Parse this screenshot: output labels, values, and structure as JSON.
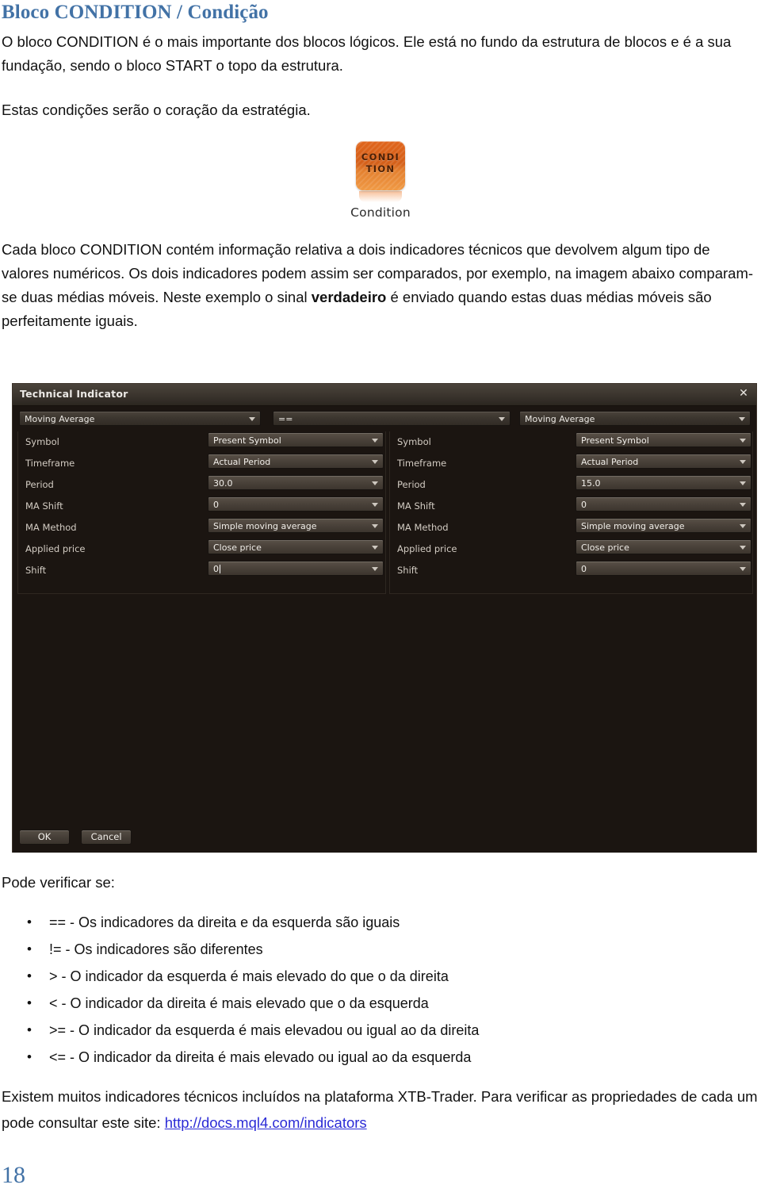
{
  "document": {
    "heading": "Bloco CONDITION / Condição",
    "paragraph_1_a": "O bloco CONDITION é o mais importante dos blocos lógicos. Ele está no fundo da estrutura de blocos e é a sua fundação, sendo o bloco START o topo da estrutura.",
    "paragraph_2": "Estas condições serão o coração da estratégia.",
    "paragraph_3_part1": "Cada bloco CONDITION contém informação relativa a dois indicadores técnicos que devolvem algum tipo de valores numéricos. Os dois indicadores podem assim ser comparados, por exemplo, na imagem abaixo comparam-se duas médias móveis. Neste exemplo o sinal ",
    "paragraph_3_bold": "verdadeiro",
    "paragraph_3_part2": " é enviado quando estas duas médias móveis são perfeitamente iguais.",
    "lead_line": "Pode verificar se:",
    "bullets": [
      "== - Os indicadores da direita e da esquerda são iguais",
      "!= - Os indicadores são diferentes",
      "> - O indicador da esquerda é mais elevado do que o da direita",
      "< - O indicador da direita é mais elevado que o da esquerda",
      ">= - O indicador da esquerda é mais elevadou ou igual ao da direita",
      "<= - O indicador da  direita é mais elevado ou igual ao da esquerda"
    ],
    "tail_part1": "Existem muitos indicadores técnicos incluídos na plataforma XTB-Trader. Para verificar as propriedades de cada um pode consultar este site: ",
    "tail_link": "http://docs.mql4.com/indicators",
    "page_number": "18",
    "heading_color": "#4272a6",
    "link_color": "#2b2bd6"
  },
  "figure": {
    "icon_line_1": "CONDI",
    "icon_line_2": "TION",
    "caption": "Condition",
    "icon_color": "#e0651c"
  },
  "dialog": {
    "title": "Technical Indicator",
    "close_label": "✕",
    "selector_row": {
      "left_indicator": "Moving Average",
      "operator": "==",
      "right_indicator": "Moving Average"
    },
    "left_panel": {
      "rows": [
        {
          "label": "Symbol",
          "value": "Present Symbol"
        },
        {
          "label": "Timeframe",
          "value": "Actual Period"
        },
        {
          "label": "Period",
          "value": "30.0"
        },
        {
          "label": "MA Shift",
          "value": "0"
        },
        {
          "label": "MA Method",
          "value": "Simple moving average"
        },
        {
          "label": "Applied price",
          "value": "Close price"
        },
        {
          "label": "Shift",
          "value": "0"
        }
      ]
    },
    "right_panel": {
      "rows": [
        {
          "label": "Symbol",
          "value": "Present Symbol"
        },
        {
          "label": "Timeframe",
          "value": "Actual Period"
        },
        {
          "label": "Period",
          "value": "15.0"
        },
        {
          "label": "MA Shift",
          "value": "0"
        },
        {
          "label": "MA Method",
          "value": "Simple moving average"
        },
        {
          "label": "Applied price",
          "value": "Close price"
        },
        {
          "label": "Shift",
          "value": "0"
        }
      ]
    },
    "buttons": {
      "ok": "OK",
      "cancel": "Cancel"
    }
  }
}
